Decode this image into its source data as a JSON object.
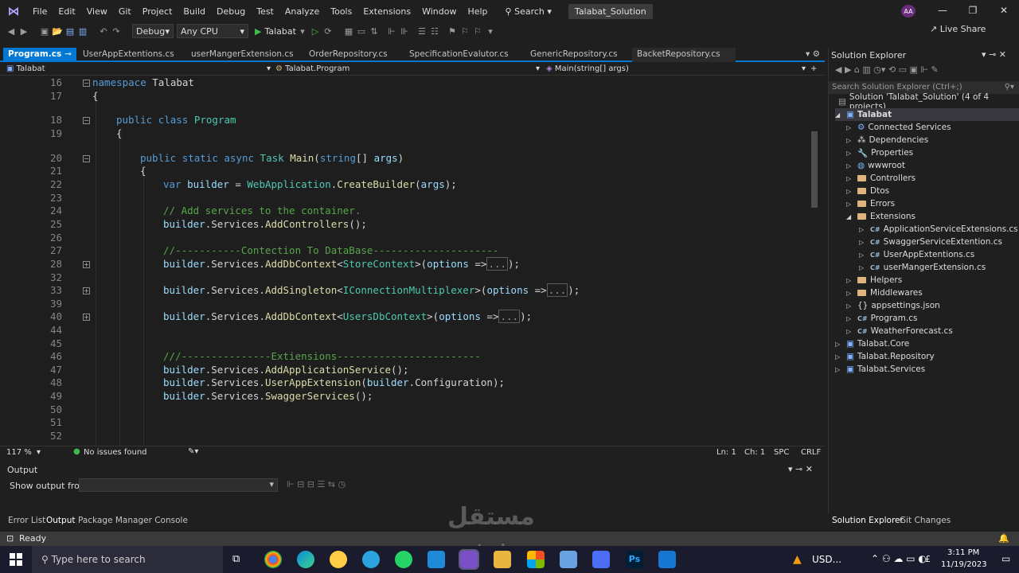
{
  "menu": {
    "items": [
      "File",
      "Edit",
      "View",
      "Git",
      "Project",
      "Build",
      "Debug",
      "Test",
      "Analyze",
      "Tools",
      "Extensions",
      "Window",
      "Help"
    ],
    "search_label": "Search",
    "solution_title": "Talabat_Solution",
    "avatar_initials": "AA"
  },
  "toolbar": {
    "config": "Debug",
    "platform": "Any CPU",
    "run_target": "Talabat",
    "live_share": "Live Share"
  },
  "tabs": [
    {
      "label": "Program.cs",
      "active": true
    },
    {
      "label": "UserAppExtentions.cs"
    },
    {
      "label": "userMangerExtension.cs"
    },
    {
      "label": "OrderRepository.cs"
    },
    {
      "label": "SpecificationEvalutor.cs"
    },
    {
      "label": "GenericRepository.cs"
    },
    {
      "label": "BacketRepository.cs"
    }
  ],
  "nav": {
    "project": "Talabat",
    "type": "Talabat.Program",
    "member": "Main(string[] args)"
  },
  "code_lines": [
    "16",
    "17",
    "18",
    "19",
    "20",
    "21",
    "22",
    "23",
    "24",
    "25",
    "26",
    "27",
    "28",
    "32",
    "33",
    "39",
    "40",
    "44",
    "45",
    "46",
    "47",
    "48",
    "49",
    "50",
    "51",
    "52"
  ],
  "editor_status": {
    "zoom": "117 %",
    "issues": "No issues found",
    "ln": "Ln: 1",
    "ch": "Ch: 1",
    "spc": "SPC",
    "eol": "CRLF"
  },
  "output": {
    "title": "Output",
    "show_from": "Show output from:"
  },
  "bottom_tabs": [
    "Error List",
    "Output",
    "Package Manager Console"
  ],
  "right_bottom_tabs": [
    "Solution Explorer",
    "Git Changes"
  ],
  "status": {
    "ready": "Ready"
  },
  "solution_explorer": {
    "title": "Solution Explorer",
    "search_placeholder": "Search Solution Explorer (Ctrl+;)",
    "solution": "Solution 'Talabat_Solution' (4 of 4 projects)",
    "project": "Talabat",
    "items": [
      "Connected Services",
      "Dependencies",
      "Properties",
      "wwwroot",
      "Controllers",
      "Dtos",
      "Errors",
      "Extensions",
      "ApplicationServiceExtensions.cs",
      "SwaggerServiceExtention.cs",
      "UserAppExtentions.cs",
      "userMangerExtension.cs",
      "Helpers",
      "Middlewares",
      "appsettings.json",
      "Program.cs",
      "WeatherForecast.cs"
    ],
    "projects": [
      "Talabat.Core",
      "Talabat.Repository",
      "Talabat.Services"
    ]
  },
  "taskbar": {
    "search_placeholder": "Type here to search",
    "currency": "USD...",
    "time": "3:11 PM",
    "date": "11/19/2023",
    "lang": "£"
  },
  "watermark": "mostaql.com"
}
